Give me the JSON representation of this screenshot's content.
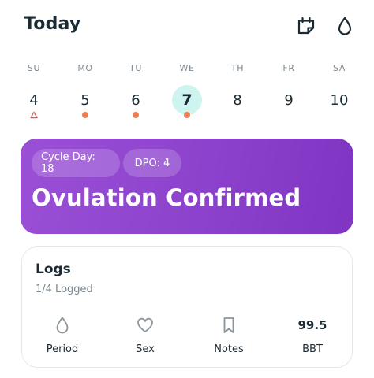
{
  "header": {
    "title": "Today",
    "icons": [
      "calendar-edit-icon",
      "drop-icon"
    ]
  },
  "week": {
    "days": [
      {
        "label": "SU",
        "number": "4",
        "marker": "triangle"
      },
      {
        "label": "MO",
        "number": "5",
        "marker": "dot"
      },
      {
        "label": "TU",
        "number": "6",
        "marker": "dot"
      },
      {
        "label": "WE",
        "number": "7",
        "marker": "dot",
        "selected": true
      },
      {
        "label": "TH",
        "number": "8",
        "marker": "none"
      },
      {
        "label": "FR",
        "number": "9",
        "marker": "none"
      },
      {
        "label": "SA",
        "number": "10",
        "marker": "none"
      }
    ],
    "dot_color": "#ea7f56",
    "triangle_color": "#e05a5a",
    "selected_bg": "#cdf4ee"
  },
  "banner": {
    "cycle_day": "Cycle Day: 18",
    "dpo": "DPO: 4",
    "title": "Ovulation Confirmed",
    "color": "#8c42cc"
  },
  "logs": {
    "title": "Logs",
    "subtitle": "1/4 Logged",
    "items": [
      {
        "label": "Period",
        "icon": "drop-icon"
      },
      {
        "label": "Sex",
        "icon": "heart-icon"
      },
      {
        "label": "Notes",
        "icon": "bookmark-icon"
      },
      {
        "label": "BBT",
        "value": "99.5"
      }
    ]
  }
}
